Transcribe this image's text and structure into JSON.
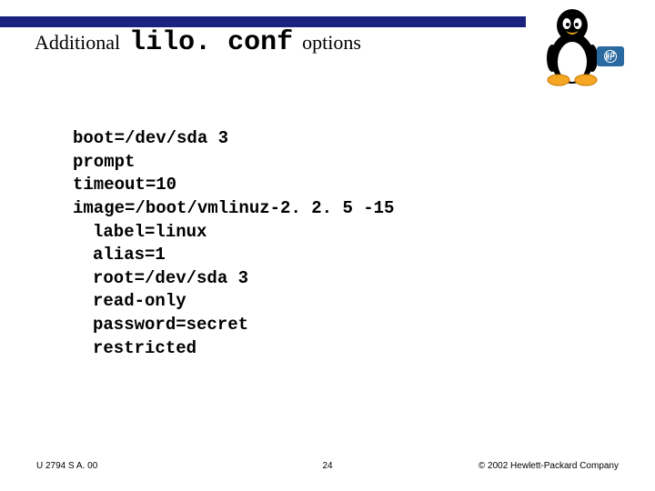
{
  "title": {
    "pre": "Additional",
    "code": "lilo. conf",
    "post": "options"
  },
  "config": {
    "l1": "boot=/dev/sda 3",
    "l2": "prompt",
    "l3": "timeout=10",
    "l4": "image=/boot/vmlinuz-2. 2. 5 -15",
    "l5": "label=linux",
    "l6": "alias=1",
    "l7": "root=/dev/sda 3",
    "l8": "read-only",
    "l9": "password=secret",
    "l10": "restricted"
  },
  "footer": {
    "left": "U 2794 S A. 00",
    "center": "24",
    "right": "© 2002 Hewlett-Packard Company"
  },
  "icons": {
    "penguin": "tux-penguin-icon",
    "hp": "hp-logo-icon"
  }
}
